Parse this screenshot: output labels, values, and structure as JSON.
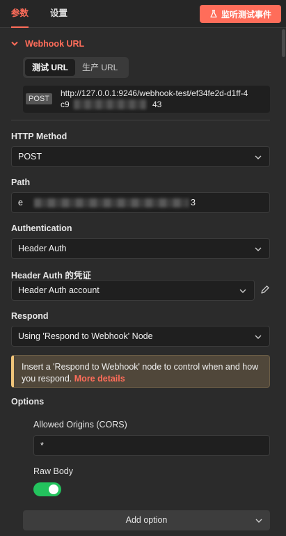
{
  "tabs": {
    "params": "参数",
    "settings": "设置"
  },
  "listen_button": {
    "label": "监听测试事件",
    "icon": "flask-icon"
  },
  "webhook_url": {
    "section_title": "Webhook URL",
    "tabs": [
      "测试 URL",
      "生产 URL"
    ],
    "method": "POST",
    "url_line1": "http://127.0.0.1:9246/webhook-test/ef34fe2d-d1ff-4",
    "url_line2_start": "c9",
    "url_line2_end": "43"
  },
  "http_method": {
    "label": "HTTP Method",
    "value": "POST"
  },
  "path": {
    "label": "Path",
    "value_start": "e",
    "value_end": "3"
  },
  "authentication": {
    "label": "Authentication",
    "value": "Header Auth"
  },
  "credential": {
    "label": "Header Auth 的凭证",
    "value": "Header Auth account"
  },
  "respond": {
    "label": "Respond",
    "value": "Using 'Respond to Webhook' Node"
  },
  "notice": {
    "text": "Insert a 'Respond to Webhook' node to control when and how you respond.",
    "link": "More details"
  },
  "options": {
    "title": "Options",
    "allowed_origins_label": "Allowed Origins (CORS)",
    "allowed_origins_value": "*",
    "raw_body_label": "Raw Body",
    "raw_body_enabled": true
  },
  "add_option": {
    "label": "Add option"
  },
  "colors": {
    "accent": "#ff6d5a",
    "toggle_on": "#23c35d",
    "notice_border": "#f0c479"
  }
}
